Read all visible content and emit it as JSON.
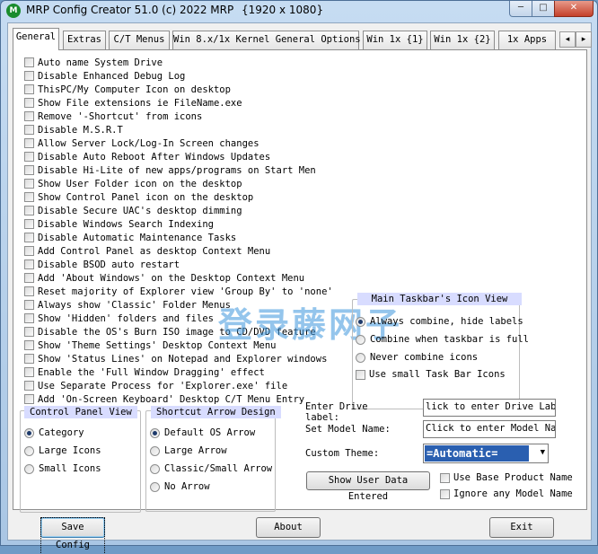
{
  "window": {
    "title": "MRP Config Creator 51.0 (c) 2022 MRP",
    "resolution": "{1920 x 1080}",
    "app_icon_glyph": "M",
    "controls": {
      "minimize": "─",
      "maximize": "□",
      "close": "✕"
    }
  },
  "tabs": [
    "General",
    "Extras",
    "C/T Menus",
    "Win 8.x/1x Kernel General Options",
    "Win 1x {1}",
    "Win 1x {2}",
    "1x Apps"
  ],
  "tab_scroll": {
    "left": "◂",
    "right": "▸"
  },
  "options": [
    "Auto name System Drive",
    "Disable Enhanced Debug Log",
    "ThisPC/My Computer Icon on desktop",
    "Show File extensions ie FileName.exe",
    "Remove '-Shortcut' from icons",
    "Disable M.S.R.T",
    "Allow Server Lock/Log-In Screen changes",
    "Disable Auto Reboot After Windows Updates",
    "Disable Hi-Lite of new apps/programs on Start Men",
    "Show User Folder icon on the desktop",
    "Show Control Panel icon on the desktop",
    "Disable Secure UAC's desktop dimming",
    "Disable Windows Search Indexing",
    "Disable Automatic Maintenance Tasks",
    "Add Control Panel as desktop Context Menu",
    "Disable BSOD auto restart",
    "Add 'About Windows' on the Desktop Context Menu",
    "Reset majority of Explorer view 'Group By' to 'none'",
    "Always show 'Classic' Folder Menus",
    "Show 'Hidden' folders and files",
    "Disable the OS's Burn ISO image to CD/DVD feature",
    "Show 'Theme Settings' Desktop Context Menu",
    "Show 'Status Lines' on Notepad and Explorer windows",
    "Enable the 'Full Window Dragging' effect",
    "Use Separate Process for 'Explorer.exe' file",
    "Add 'On-Screen Keyboard' Desktop C/T Menu Entry"
  ],
  "taskbar_group": {
    "title": "Main Taskbar's Icon View",
    "options": [
      "Always combine, hide labels",
      "Combine when taskbar is full",
      "Never combine icons"
    ],
    "selected": 0,
    "checkbox": "Use small Task Bar Icons"
  },
  "control_panel_group": {
    "title": "Control Panel View",
    "options": [
      "Category",
      "Large Icons",
      "Small Icons"
    ],
    "selected": 0
  },
  "shortcut_group": {
    "title": "Shortcut Arrow Design",
    "options": [
      "Default OS Arrow",
      "Large Arrow",
      "Classic/Small Arrow",
      "No Arrow"
    ],
    "selected": 0
  },
  "drive_label": {
    "label_line1": "Enter Drive",
    "label_line2": "label:",
    "value": "lick to enter Drive Labe"
  },
  "model_name": {
    "label": "Set Model Name:",
    "value": "Click to enter Model Name"
  },
  "theme": {
    "label": "Custom Theme:",
    "value": "=Automatic=",
    "arrow": "▼"
  },
  "show_user_data_button": "Show User Data Entered",
  "base_product_checkbox": "Use Base Product Name",
  "ignore_model_checkbox": "Ignore any Model Name",
  "footer": {
    "save": "Save Config",
    "about": "About",
    "exit": "Exit"
  },
  "watermark": "登录藤网子"
}
